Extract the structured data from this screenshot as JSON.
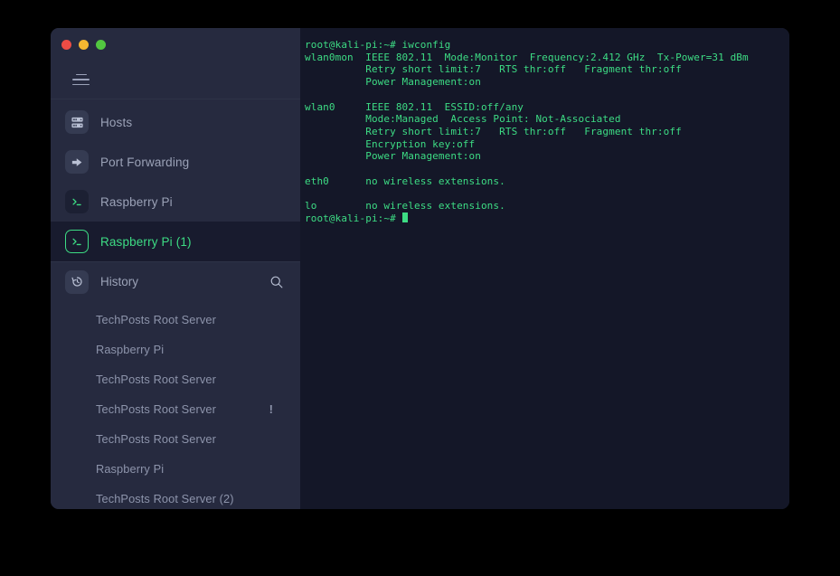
{
  "window": {
    "traffic_lights": [
      {
        "name": "close",
        "color": "#ed4c45"
      },
      {
        "name": "minimize",
        "color": "#f5b731"
      },
      {
        "name": "maximize",
        "color": "#52c740"
      }
    ]
  },
  "sidebar": {
    "menu_button": "menu-icon",
    "nav": [
      {
        "label": "Hosts",
        "icon": "server-rack-icon",
        "active": false
      },
      {
        "label": "Port Forwarding",
        "icon": "arrow-forward-icon",
        "active": false
      },
      {
        "label": "Raspberry Pi",
        "icon": "terminal-icon",
        "active": false
      },
      {
        "label": "Raspberry Pi (1)",
        "icon": "terminal-icon",
        "active": true
      }
    ],
    "history": {
      "title": "History",
      "icon": "history-clock-icon",
      "search_icon": "search-icon",
      "items": [
        {
          "label": "TechPosts Root Server",
          "alert": ""
        },
        {
          "label": "Raspberry Pi",
          "alert": ""
        },
        {
          "label": "TechPosts Root Server",
          "alert": ""
        },
        {
          "label": "TechPosts Root Server",
          "alert": "!"
        },
        {
          "label": "TechPosts Root Server",
          "alert": ""
        },
        {
          "label": "Raspberry Pi",
          "alert": ""
        },
        {
          "label": "TechPosts Root Server (2)",
          "alert": ""
        }
      ]
    }
  },
  "terminal": {
    "prompt": "root@kali-pi:~#",
    "command": "iwconfig",
    "output": "root@kali-pi:~# iwconfig\nwlan0mon  IEEE 802.11  Mode:Monitor  Frequency:2.412 GHz  Tx-Power=31 dBm\n          Retry short limit:7   RTS thr:off   Fragment thr:off\n          Power Management:on\n\nwlan0     IEEE 802.11  ESSID:off/any\n          Mode:Managed  Access Point: Not-Associated\n          Retry short limit:7   RTS thr:off   Fragment thr:off\n          Encryption key:off\n          Power Management:on\n\neth0      no wireless extensions.\n\nlo        no wireless extensions.\n",
    "last_prompt": "root@kali-pi:~# ",
    "foreground_color": "#3ddc84",
    "background_color": "#141728"
  }
}
